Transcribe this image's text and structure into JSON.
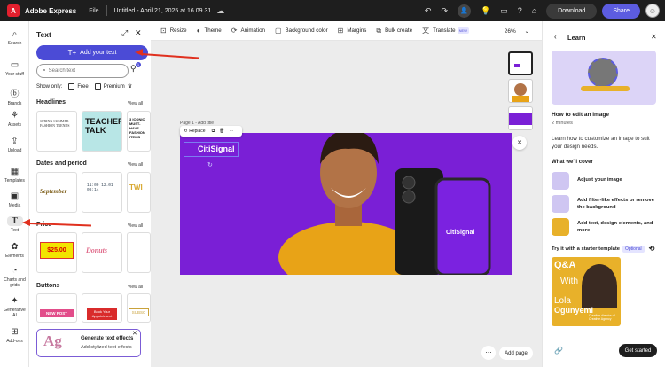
{
  "app": {
    "name": "Adobe Express",
    "file_menu": "File",
    "doc_title": "Untitled - April 21, 2025 at 16.09.31"
  },
  "topbar": {
    "download_label": "Download",
    "share_label": "Share"
  },
  "rail": {
    "items": [
      {
        "label": "Search",
        "icon": "search-icon"
      },
      {
        "label": "Your stuff",
        "icon": "folder-icon"
      },
      {
        "label": "Brands",
        "icon": "brand-icon"
      },
      {
        "label": "Assets",
        "icon": "assets-icon"
      },
      {
        "label": "Upload",
        "icon": "upload-icon"
      },
      {
        "label": "Templates",
        "icon": "templates-icon"
      },
      {
        "label": "Media",
        "icon": "media-icon"
      },
      {
        "label": "Text",
        "icon": "text-icon"
      },
      {
        "label": "Elements",
        "icon": "elements-icon"
      },
      {
        "label": "Charts and grids",
        "icon": "charts-icon"
      },
      {
        "label": "Generative AI",
        "icon": "sparkle-icon"
      },
      {
        "label": "Add-ons",
        "icon": "addons-icon"
      }
    ]
  },
  "panel": {
    "title": "Text",
    "add_text_label": "Add your text",
    "search_placeholder": "Search text",
    "filter_badge": "1",
    "show_only_label": "Show only:",
    "free_label": "Free",
    "premium_label": "Premium",
    "sections": [
      {
        "title": "Headlines",
        "view_all": "View all"
      },
      {
        "title": "Dates and period",
        "view_all": "View all"
      },
      {
        "title": "Price",
        "view_all": "View all"
      },
      {
        "title": "Buttons",
        "view_all": "View all"
      }
    ],
    "thumbs": {
      "headlines": [
        "SPRING SUMMER FASHION TRENDS",
        "TEACHER TALK",
        "3 ICONIC MUST-HAVE FASHION ITEMS"
      ],
      "dates": [
        "September",
        "11:00 12.01 08:14",
        "TWI"
      ],
      "price": [
        "$25.00",
        "Donuts",
        ""
      ],
      "buttons": [
        "NEW POST",
        "Book Your Appointment",
        "SUBSC"
      ]
    },
    "gen_effects": {
      "glyph": "Ag",
      "title": "Generate text effects",
      "subtitle": "Add stylized text effects"
    }
  },
  "toolbar": {
    "items": [
      {
        "label": "Resize",
        "icon": "resize-icon"
      },
      {
        "label": "Theme",
        "icon": "theme-icon"
      },
      {
        "label": "Animation",
        "icon": "animation-icon"
      },
      {
        "label": "Background color",
        "icon": "color-swatch-icon"
      },
      {
        "label": "Margins",
        "icon": "margins-icon"
      },
      {
        "label": "Bulk create",
        "icon": "bulk-icon"
      },
      {
        "label": "Translate",
        "icon": "translate-icon"
      }
    ],
    "new_badge": "NEW",
    "zoom": "26%"
  },
  "canvas": {
    "page_label": "Page 1 - Add title",
    "replace_label": "Replace",
    "headline_text": "CitiSignal",
    "phone_text": "CitiSignal",
    "add_page_label": "Add page",
    "background_color": "#7a1fd6"
  },
  "learn": {
    "title": "Learn",
    "lesson_title": "How to edit an image",
    "duration": "2 minutes",
    "description": "Learn how to customize an image to suit your design needs.",
    "cover_heading": "What we'll cover",
    "cover_items": [
      "Adjust your image",
      "Add filter-like effects or remove the background",
      "Add text, design elements, and more"
    ],
    "starter_label": "Try it with a starter template",
    "optional_label": "Optional",
    "starter_card": {
      "line1": "Q&A",
      "line2": "With",
      "line3": "Lola",
      "line4": "Ogunyemi",
      "line5": "Creative director of Creative Agency"
    },
    "get_started": "Get started"
  }
}
